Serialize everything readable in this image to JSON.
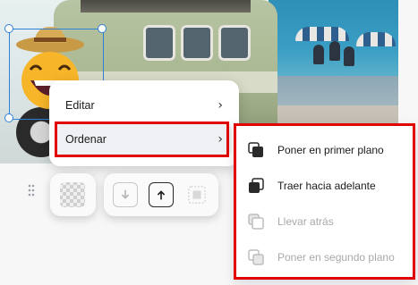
{
  "context_menu": {
    "items": [
      {
        "label": "Editar"
      },
      {
        "label": "Ordenar"
      }
    ]
  },
  "submenu": {
    "items": [
      {
        "label": "Poner en primer plano",
        "enabled": true
      },
      {
        "label": "Traer hacia adelante",
        "enabled": true
      },
      {
        "label": "Llevar atrás",
        "enabled": false
      },
      {
        "label": "Poner en segundo plano",
        "enabled": false
      }
    ]
  },
  "colors": {
    "highlight": "#e00000",
    "selection": "#2f80d8",
    "disabled_text": "#a9a9a9"
  },
  "icons": {
    "chevron": "chevron-right-icon",
    "grip": "drag-grip-icon"
  }
}
